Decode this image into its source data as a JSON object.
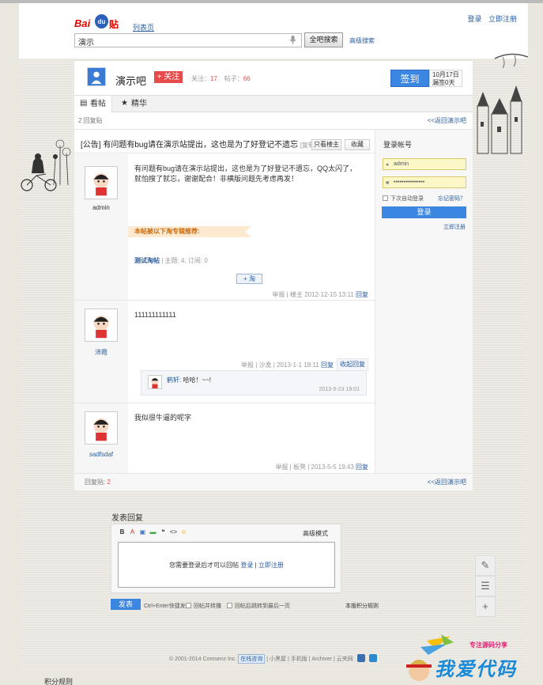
{
  "top_links": {
    "login": "登录",
    "register": "立即注册"
  },
  "logo": {
    "bai": "Bai",
    "du": "du",
    "tieba": "贴吧"
  },
  "list_page": "列表页",
  "search": {
    "value": "演示",
    "button": "全吧搜索",
    "advanced": "高级搜索"
  },
  "forum": {
    "name": "演示吧",
    "follow_label": "+ 关注",
    "followers_label": "关注：",
    "followers": "17",
    "posts_label": "帖子：",
    "posts": "66",
    "sign_label": "签到",
    "sign_date": "10月17日",
    "sign_streak": "漏签0天"
  },
  "tabs": [
    {
      "label": "看帖",
      "icon": "▤"
    },
    {
      "label": "精华",
      "icon": "★"
    }
  ],
  "reply_bar": {
    "count": "2 回复贴",
    "back": "<<返回演示吧"
  },
  "notice": {
    "tag": "[公告]",
    "text": "有问题有bug请在演示站提出，这也是为了好登记不遗忘",
    "copy": "[复制链接]"
  },
  "post_buttons": {
    "owner_only": "只看楼主",
    "favorite": "收藏"
  },
  "posts": [
    {
      "user": "admin",
      "text": "有问题有bug请在演示站提出，这也是为了好登记不遗忘，QQ太闪了，就怕搜了就忘，谢谢配合！非横版问题先考虑再发！",
      "ribbon": "本帖被以下淘专辑推荐:",
      "album_link": "测试淘帖",
      "album_meta": "| 主题: 4, 订阅: 0",
      "plus_label": "+ 淘",
      "report": "举报",
      "floor": "楼主",
      "time": "2012-12-15 13:11",
      "reply": "回复"
    },
    {
      "user": "沛霞",
      "text": "111111111111",
      "report": "举报",
      "floor": "沙发",
      "time": "2013-1-1 18:11",
      "reply": "回复",
      "collapse": "收起回复",
      "sub_reply": {
        "name": "鹤轩:",
        "text": "哈哈！~~!",
        "time": "2013-5-23 19:01"
      }
    },
    {
      "user": "sadfsdaf",
      "text": "我似很牛逼的呢字",
      "report": "举报",
      "floor": "板凳",
      "time": "2013-5-5 19:43",
      "reply": "回复"
    }
  ],
  "login_box": {
    "title": "登录帐号",
    "username": "admin",
    "password": "••••••••••••••••",
    "remember": "下次自动登录",
    "forgot": "忘记密码？",
    "login": "登录",
    "register": "立即注册"
  },
  "foot_bar": {
    "label": "回复贴:",
    "count": "2",
    "back": "<<返回演示吧"
  },
  "reply_form": {
    "title": "发表回复",
    "toolbar": [
      "B",
      "A",
      "▣",
      "▬",
      "❝",
      "<>",
      "☺"
    ],
    "advanced": "高级模式",
    "prompt": "您需要登录后才可以回帖",
    "login": "登录",
    "register": "立即注册",
    "submit": "发表",
    "hint": "Ctrl+Enter快捷发表",
    "opt1": "回帖并转播",
    "opt2": "回帖后跳转到最后一页",
    "rules": "本版积分规则"
  },
  "side_tools": [
    "✎",
    "☰",
    "+"
  ],
  "footer": {
    "copyright": "© 2001-2014 Comsenz Inc.",
    "badge": "在线咨询",
    "links": "| 小黑屋 | 手机版 | Archiver | 云夹网"
  },
  "watermark": {
    "small": "专注源码分享",
    "big": "我爱代码"
  },
  "bottom_left": "积分规则",
  "colors": {
    "accent": "#3b86e0",
    "follow": "#e64a4a",
    "link": "#2b5e9c"
  }
}
